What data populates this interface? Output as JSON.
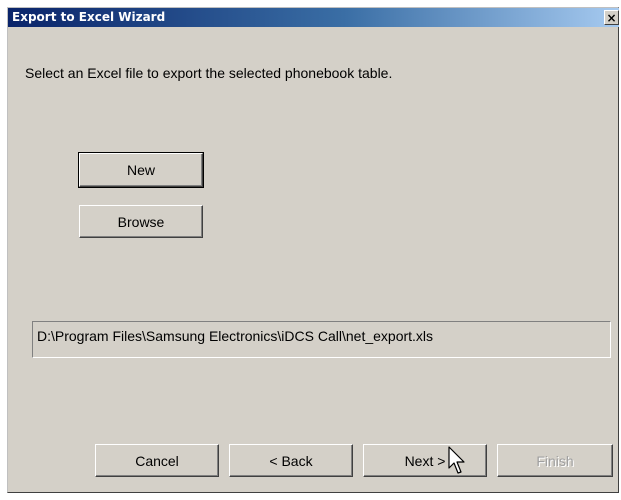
{
  "window": {
    "title": "Export to Excel Wizard",
    "close_glyph": "×"
  },
  "instruction": "Select an Excel file to export the selected phonebook table.",
  "buttons": {
    "new": "New",
    "browse": "Browse",
    "cancel": "Cancel",
    "back": "< Back",
    "next": "Next >",
    "finish": "Finish"
  },
  "file_path": "D:\\Program Files\\Samsung Electronics\\iDCS Call\\net_export.xls",
  "state": {
    "finish_enabled": false
  },
  "colors": {
    "window_bg": "#d4d0c8",
    "titlebar_start": "#0a246a",
    "titlebar_end": "#a6caf0",
    "disabled_text": "#a0a0a0"
  },
  "icons": {
    "close": "close-icon",
    "cursor": "mouse-pointer-icon"
  }
}
